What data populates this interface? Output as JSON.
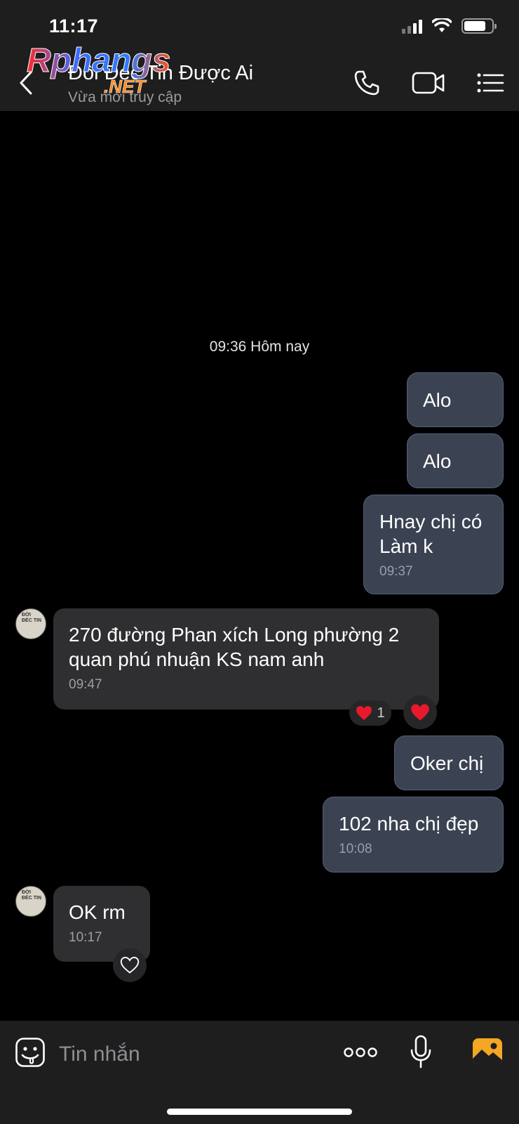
{
  "status_bar": {
    "time": "11:17"
  },
  "header": {
    "contact_name": "Đôi Đéc Tin Được Ai",
    "contact_status": "Vừa mới truy cập"
  },
  "watermark": {
    "text_main": "Rphangs",
    "text_sub": ".NET"
  },
  "conversation": {
    "time_divider": "09:36 Hôm nay",
    "messages": [
      {
        "direction": "out",
        "text": "Alo"
      },
      {
        "direction": "out",
        "text": "Alo"
      },
      {
        "direction": "out",
        "text": "Hnay chị có\nLàm k",
        "time": "09:37"
      },
      {
        "direction": "in",
        "text": "270 đường Phan xích Long phường 2\nquan phú nhuận KS nam anh",
        "time": "09:47",
        "reaction_count": "1"
      },
      {
        "direction": "out",
        "text": "Oker chị"
      },
      {
        "direction": "out",
        "text": "102 nha chị đẹp",
        "time": "10:08"
      },
      {
        "direction": "in",
        "text": "OK rm",
        "time": "10:17"
      }
    ]
  },
  "input_bar": {
    "placeholder": "Tin nhắn"
  },
  "colors": {
    "header_bg": "#1e1e1f",
    "outgoing_bubble": "#3b4252",
    "incoming_bubble": "#2f2f31",
    "heart_red": "#e8192c",
    "gallery_orange": "#f5a623"
  },
  "icons": [
    "back-icon",
    "phone-icon",
    "video-call-icon",
    "menu-list-icon",
    "sticker-icon",
    "more-icon",
    "mic-icon",
    "gallery-icon",
    "heart-icon",
    "heart-outline-icon"
  ]
}
